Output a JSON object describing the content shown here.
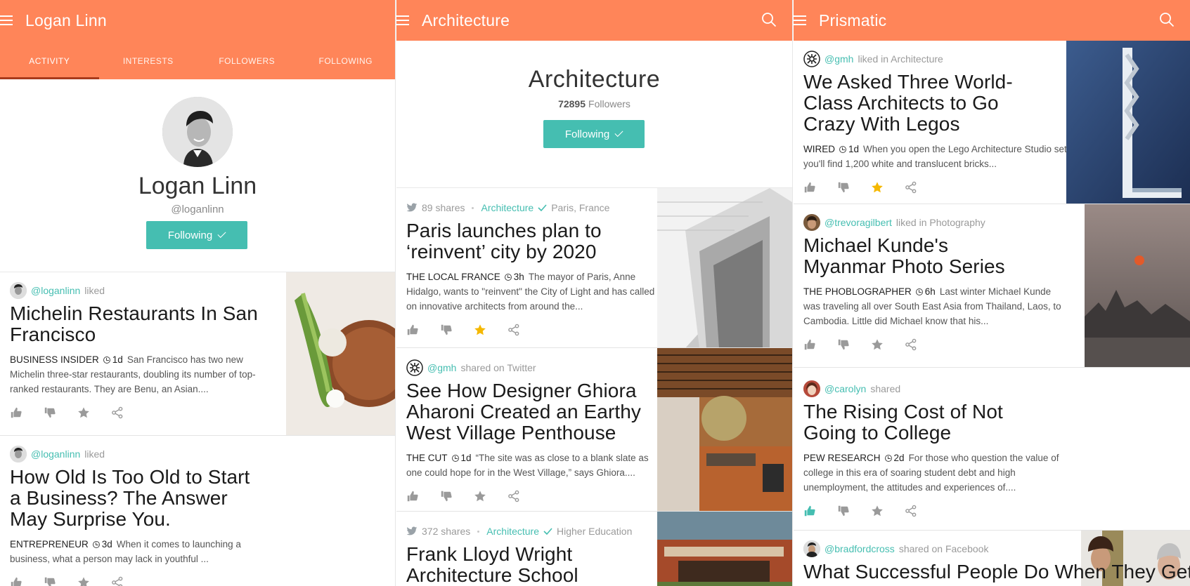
{
  "profile": {
    "topbar_title": "Logan Linn",
    "tabs": [
      "ACTIVITY",
      "INTERESTS",
      "FOLLOWERS",
      "FOLLOWING"
    ],
    "name": "Logan Linn",
    "handle": "@loganlinn",
    "follow_label": "Following",
    "cards": [
      {
        "user": "@loganlinn",
        "action": "liked",
        "title": "Michelin Restaurants In San Francisco",
        "source": "BUSINESS INSIDER",
        "age": "1d",
        "summary": "San Francisco has two new Michelin three-star restaurants, doubling its number of top-ranked restaurants. They are Benu, an Asian...."
      },
      {
        "user": "@loganlinn",
        "action": "liked",
        "title": "How Old Is Too Old to Start a Business? The Answer May Surprise You.",
        "source": "ENTREPRENEUR",
        "age": "3d",
        "summary": "When it comes to launching a business, what a person may lack in youthful ..."
      }
    ]
  },
  "topic": {
    "topbar_title": "Architecture",
    "name": "Architecture",
    "followers_count": "72895",
    "followers_label": "Followers",
    "follow_label": "Following",
    "cards": [
      {
        "shares": "89 shares",
        "topic": "Architecture",
        "location": "Paris, France",
        "title": "Paris launches plan to ‘reinvent’ city by 2020",
        "source": "THE LOCAL FRANCE",
        "age": "3h",
        "summary": "The mayor of Paris, Anne Hidalgo, wants to \"reinvent\" the City of Light and has called on innovative architects from around the...",
        "starred": true
      },
      {
        "user": "@gmh",
        "action": "shared on Twitter",
        "title": "See How Designer Ghiora Aharoni Created an Earthy West Village Penthouse",
        "source": "THE CUT",
        "age": "1d",
        "summary": "“The site was as close to a blank slate as one could hope for in the West Village,” says Ghiora....",
        "starred": false
      },
      {
        "shares": "372 shares",
        "topic": "Architecture",
        "location": "Higher Education",
        "title": "Frank Lloyd Wright Architecture School"
      }
    ]
  },
  "feed": {
    "topbar_title": "Prismatic",
    "cards": [
      {
        "user": "@gmh",
        "action": "liked in Architecture",
        "title": "We Asked Three World-Class Architects to Go Crazy With Legos",
        "source": "WIRED",
        "age": "1d",
        "summary": "When you open the Lego Architecture Studio set you'll find 1,200 white and translucent bricks...",
        "starred": true,
        "liked": false
      },
      {
        "user": "@trevoragilbert",
        "action": "liked in Photography",
        "title": "Michael Kunde's Myanmar Photo Series",
        "source": "THE PHOBLOGRAPHER",
        "age": "6h",
        "summary": "Last winter Michael Kunde was traveling all over South East Asia from Thailand, Laos, to Cambodia. Little did Michael know that his...",
        "starred": false,
        "liked": false
      },
      {
        "user": "@carolyn",
        "action": "shared",
        "title": "The Rising Cost of Not Going to College",
        "source": "PEW RESEARCH",
        "age": "2d",
        "summary": "For those who question the value of college in this era of soaring student debt and high unemployment, the attitudes and experiences of....",
        "starred": false,
        "liked": true
      },
      {
        "user": "@bradfordcross",
        "action": "shared on Facebook",
        "title": "What Successful People Do When They Get T..."
      }
    ]
  },
  "colors": {
    "accent_orange": "#ff8559",
    "teal": "#45beb1",
    "star_gold": "#f5b800",
    "tab_underline": "#a83a1c"
  },
  "icons": [
    "hamburger-icon",
    "search-icon",
    "thumbs-up-icon",
    "thumbs-down-icon",
    "star-icon",
    "share-icon",
    "clock-icon",
    "twitter-icon",
    "check-icon"
  ]
}
